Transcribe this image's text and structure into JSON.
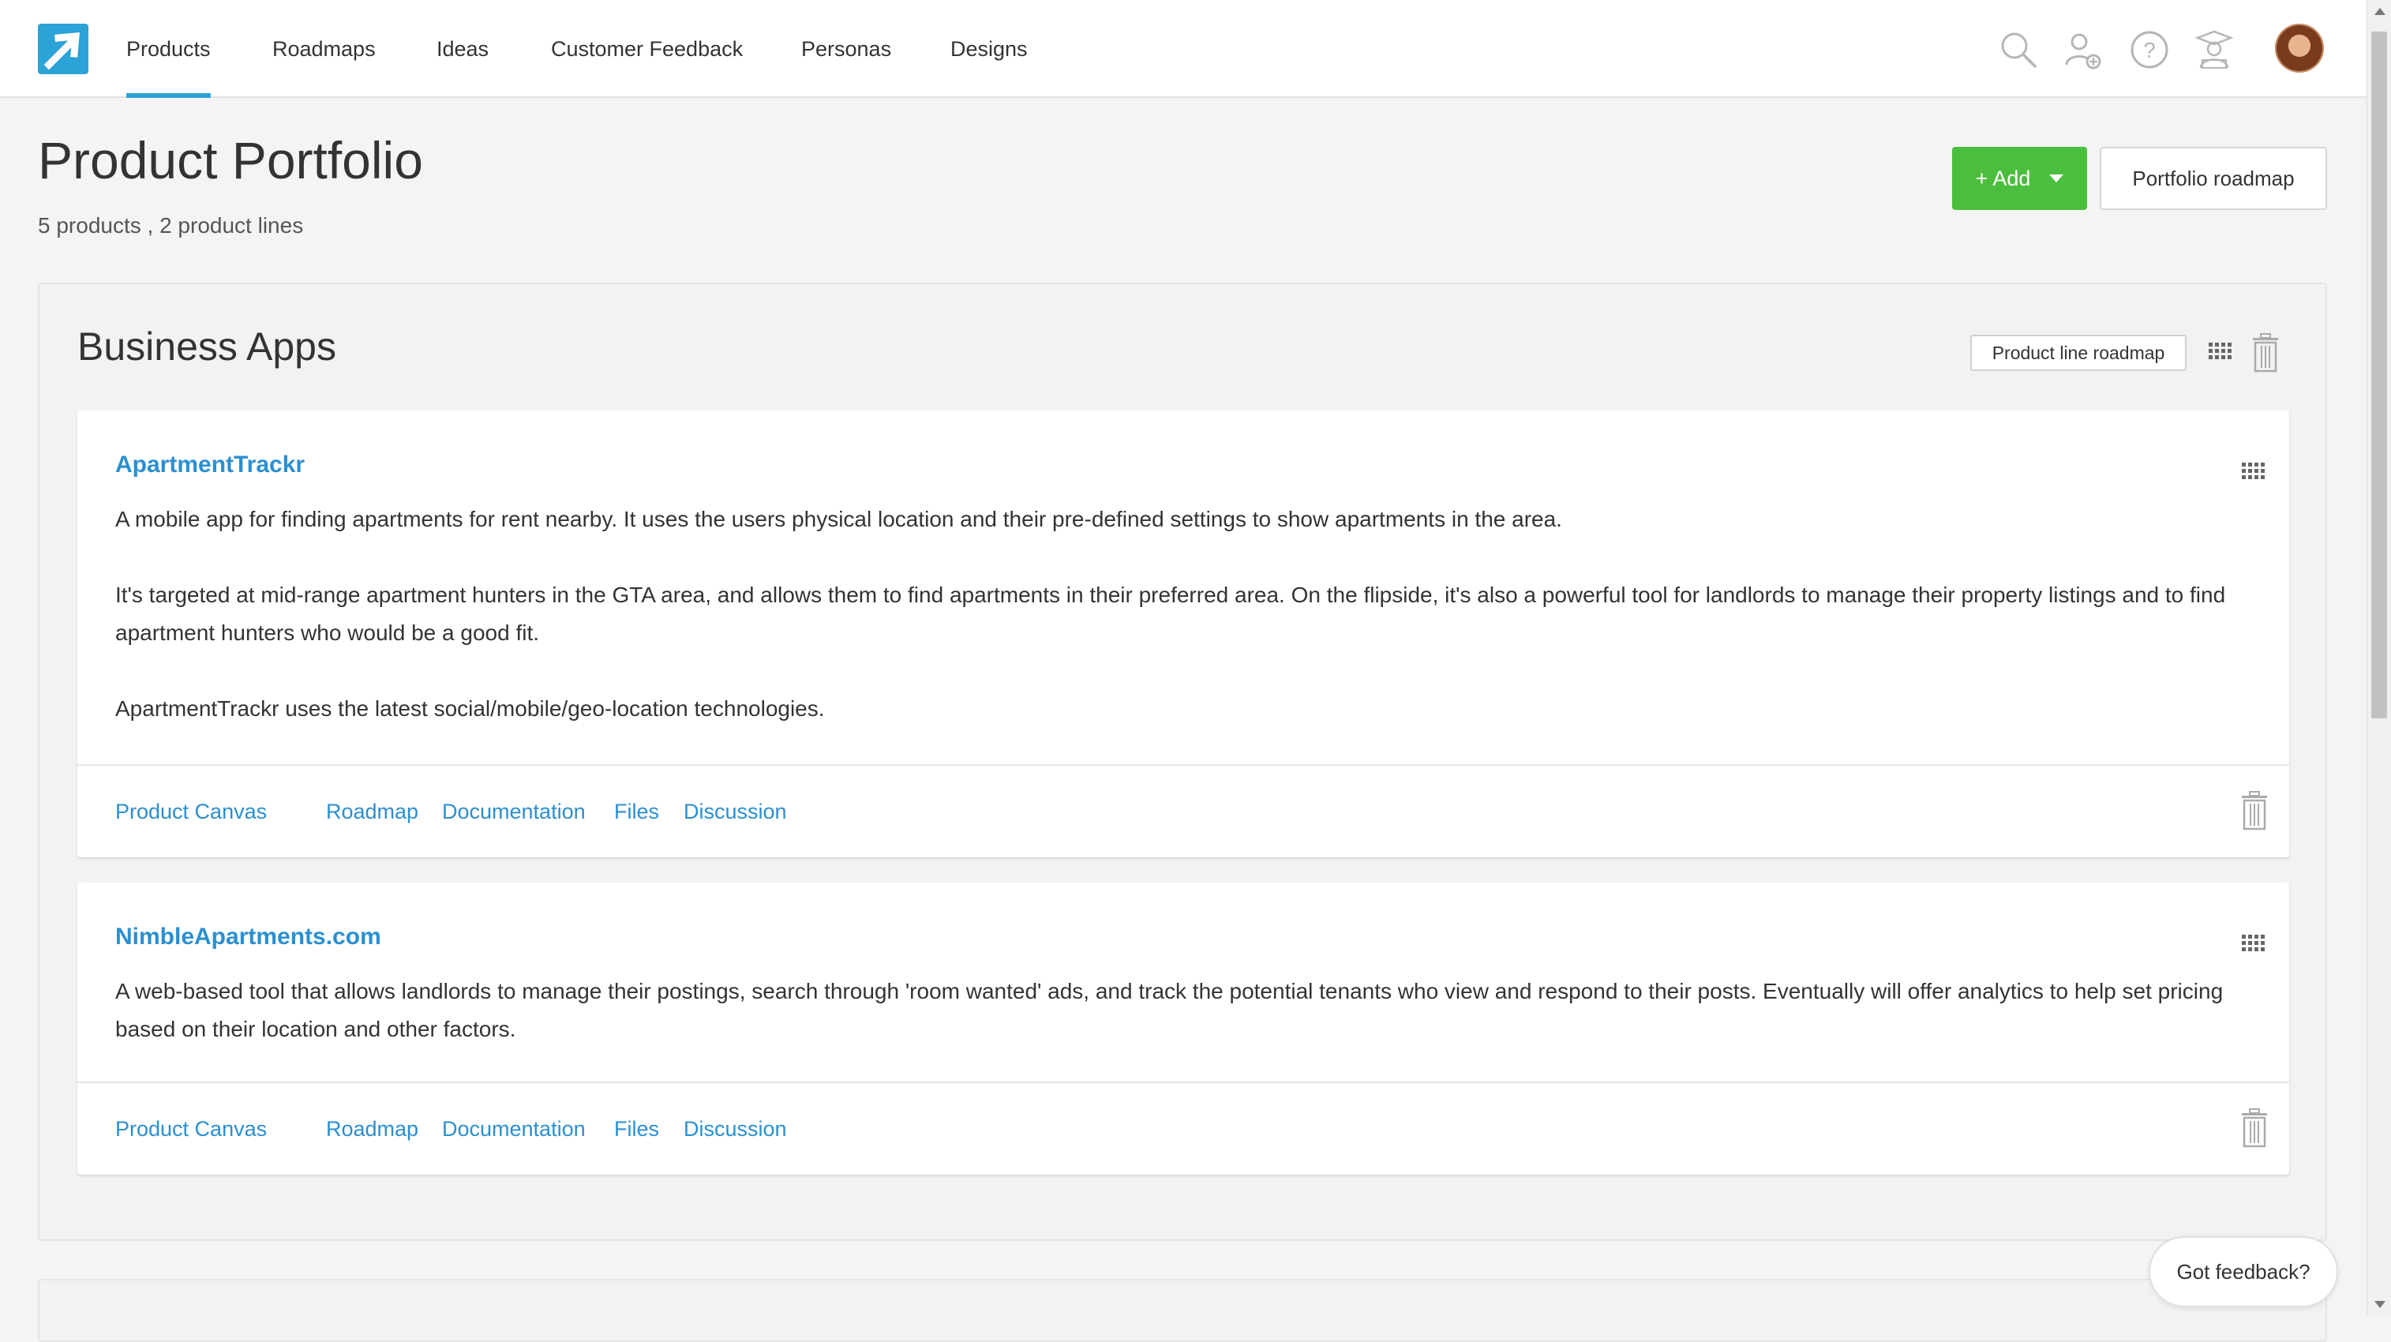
{
  "nav": {
    "items": [
      {
        "label": "Products",
        "active": true
      },
      {
        "label": "Roadmaps"
      },
      {
        "label": "Ideas"
      },
      {
        "label": "Customer Feedback"
      },
      {
        "label": "Personas"
      },
      {
        "label": "Designs"
      }
    ],
    "icons": [
      "search-icon",
      "add-user-icon",
      "help-icon",
      "academy-icon"
    ]
  },
  "header": {
    "title": "Product Portfolio",
    "subtitle": "5 products , 2 product lines",
    "add_label": "+  Add",
    "portfolio_roadmap_label": "Portfolio roadmap"
  },
  "product_line": {
    "title": "Business Apps",
    "roadmap_label": "Product line roadmap",
    "products": [
      {
        "name": "ApartmentTrackr",
        "description": [
          "A mobile app for finding apartments for rent nearby. It uses the users physical location and their pre-defined settings to show apartments in the area.",
          "It's targeted at mid-range apartment hunters in the GTA area, and allows them to find apartments in their preferred area. On the flipside, it's also a powerful tool for landlords to manage their property listings and to find apartment hunters who would be a good fit.",
          "ApartmentTrackr uses the latest social/mobile/geo-location technologies."
        ],
        "links": [
          "Product Canvas",
          "Roadmap",
          "Documentation",
          "Files",
          "Discussion"
        ]
      },
      {
        "name": "NimbleApartments.com",
        "description": [
          "A web-based tool that allows landlords to manage their postings, search through 'room wanted' ads, and track the potential tenants who view and respond to their posts. Eventually will offer analytics to help set pricing based on their location and other factors."
        ],
        "links": [
          "Product Canvas",
          "Roadmap",
          "Documentation",
          "Files",
          "Discussion"
        ]
      }
    ]
  },
  "feedback_label": "Got feedback?",
  "colors": {
    "accent": "#2ba3d6",
    "link": "#2b8fd0",
    "add_button": "#4cbe3e"
  }
}
